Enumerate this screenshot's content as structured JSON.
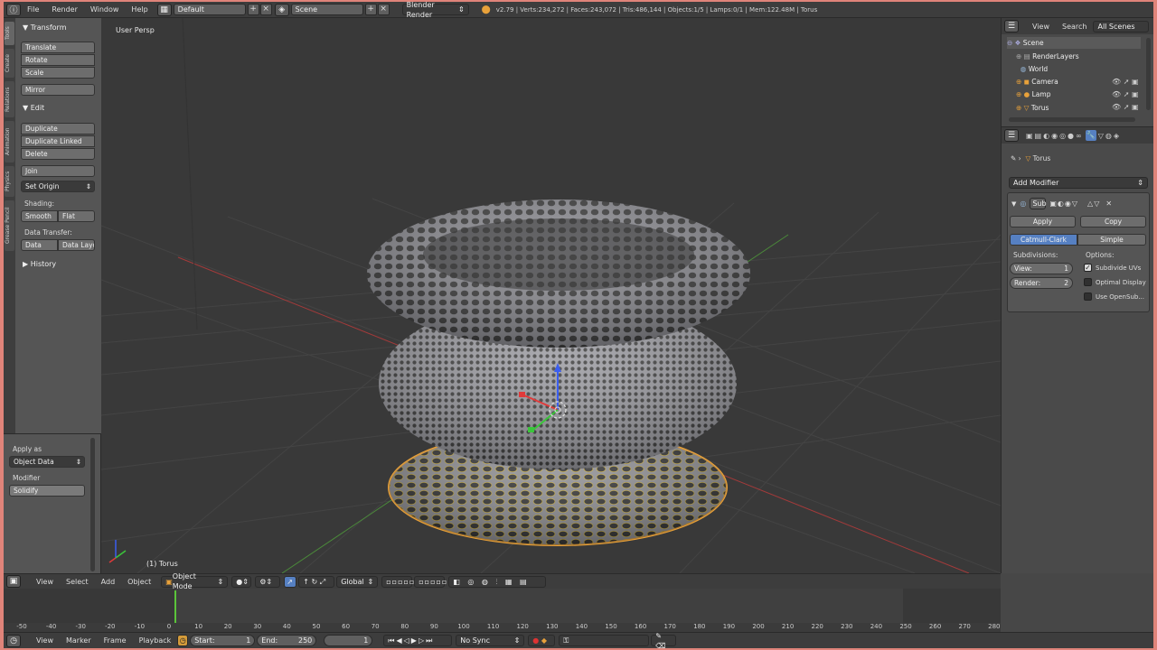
{
  "topbar": {
    "menus": [
      "File",
      "Render",
      "Window",
      "Help"
    ],
    "layout": "Default",
    "scene": "Scene",
    "engine": "Blender Render",
    "stats": "v2.79 | Verts:234,272 | Faces:243,072 | Tris:486,144 | Objects:1/5 | Lamps:0/1 | Mem:122.48M | Torus"
  },
  "left_tabs": [
    "Tools",
    "Create",
    "Relations",
    "Animation",
    "Physics",
    "Grease Pencil"
  ],
  "tools": {
    "transform_header": "Transform",
    "translate": "Translate",
    "rotate": "Rotate",
    "scale": "Scale",
    "mirror": "Mirror",
    "edit_header": "Edit",
    "duplicate": "Duplicate",
    "duplicate_linked": "Duplicate Linked",
    "delete": "Delete",
    "join": "Join",
    "set_origin": "Set Origin",
    "shading_label": "Shading:",
    "smooth": "Smooth",
    "flat": "Flat",
    "data_transfer_label": "Data Transfer:",
    "data": "Data",
    "data_layout": "Data Layo",
    "history_header": "History"
  },
  "operator": {
    "apply_as_label": "Apply as",
    "apply_as_value": "Object Data",
    "modifier_label": "Modifier",
    "modifier_value": "Solidify"
  },
  "viewport": {
    "view_label": "User Persp",
    "object_label": "(1) Torus"
  },
  "outliner": {
    "view": "View",
    "search": "Search",
    "filter": "All Scenes",
    "items": [
      {
        "label": "Scene"
      },
      {
        "label": "RenderLayers"
      },
      {
        "label": "World"
      },
      {
        "label": "Camera"
      },
      {
        "label": "Lamp"
      },
      {
        "label": "Torus"
      }
    ]
  },
  "properties": {
    "breadcrumb": "Torus",
    "add_modifier": "Add Modifier",
    "modifier_name": "Sub",
    "apply": "Apply",
    "copy": "Copy",
    "catmull": "Catmull-Clark",
    "simple": "Simple",
    "subdivisions_label": "Subdivisions:",
    "options_label": "Options:",
    "view_label": "View:",
    "view_value": "1",
    "render_label": "Render:",
    "render_value": "2",
    "opt_uvs": "Subdivide UVs",
    "opt_optimal": "Optimal Display",
    "opt_opensubdiv": "Use OpenSub..."
  },
  "view_header": {
    "menus": [
      "View",
      "Select",
      "Add",
      "Object"
    ],
    "mode": "Object Mode",
    "orientation": "Global"
  },
  "timeline": {
    "ticks": [
      "-50",
      "-40",
      "-30",
      "-20",
      "-10",
      "0",
      "10",
      "20",
      "30",
      "40",
      "50",
      "60",
      "70",
      "80",
      "90",
      "100",
      "110",
      "120",
      "130",
      "140",
      "150",
      "160",
      "170",
      "180",
      "190",
      "200",
      "210",
      "220",
      "230",
      "240",
      "250",
      "260",
      "270",
      "280"
    ],
    "current_frame_value": 1
  },
  "timeline_header": {
    "menus": [
      "View",
      "Marker",
      "Frame",
      "Playback"
    ],
    "start_label": "Start:",
    "start_value": "1",
    "end_label": "End:",
    "end_value": "250",
    "current": "1",
    "sync": "No Sync"
  },
  "colors": {
    "accent": "#5680c2",
    "selection": "#e8a13a",
    "grid_x": "#a33a3a",
    "grid_y": "#4b8a3a"
  }
}
